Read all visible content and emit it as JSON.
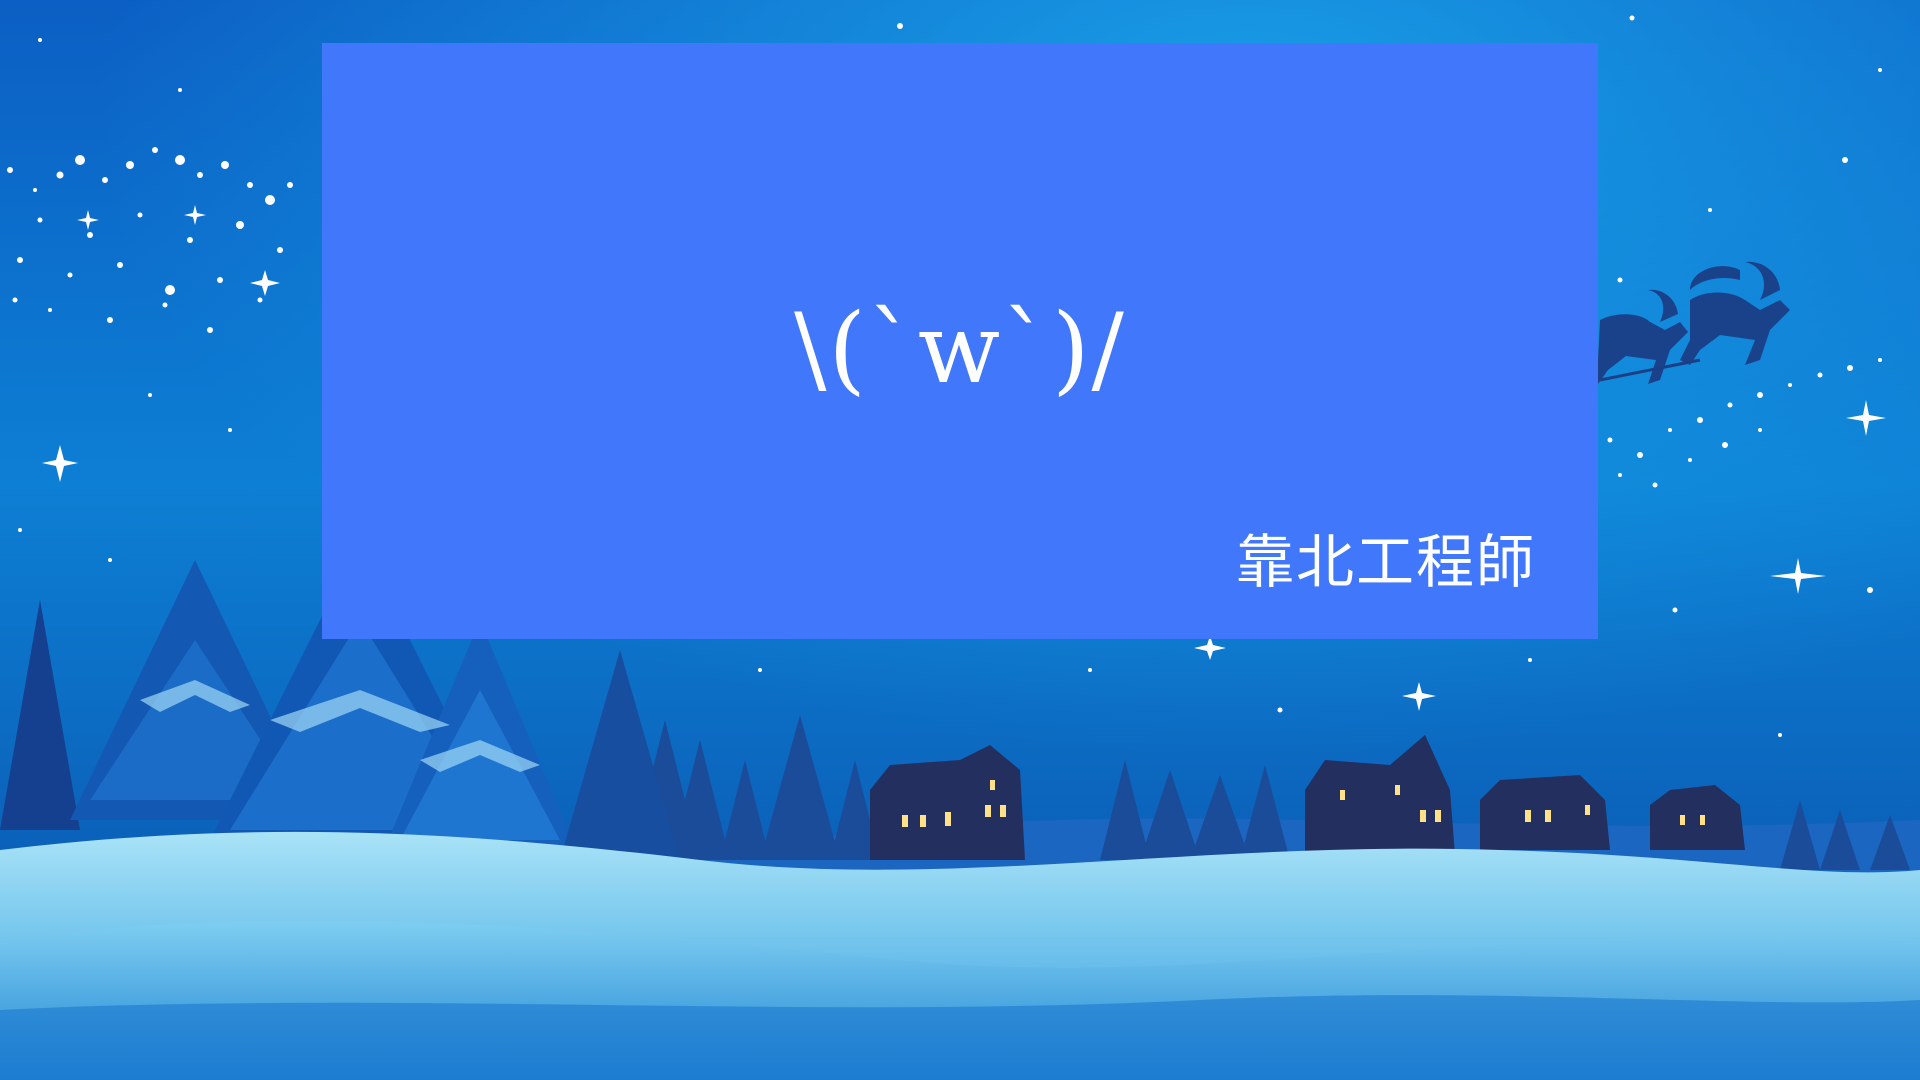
{
  "panel": {
    "kaomoji": "\\(`w`)/",
    "signature": "靠北工程師"
  },
  "colors": {
    "panel_background": "#4178fb",
    "sky_top": "#0f7fd2",
    "sky_bottom": "#0b4fb3",
    "snow": "#9fdcf5",
    "text": "#ffffff"
  },
  "icons": [
    "star-icon",
    "reindeer-icon",
    "pine-tree-icon",
    "house-icon"
  ]
}
